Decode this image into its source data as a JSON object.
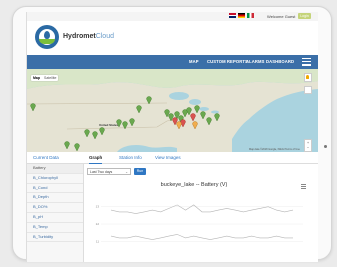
{
  "app": {
    "brand_bold": "Hydromet",
    "brand_light": "Cloud",
    "welcome": "Welcome Guest",
    "login": "Login"
  },
  "nav": {
    "map": "MAP",
    "custom_reports": "CUSTOM REPORTS",
    "alarms": "ALARMS",
    "dashboard": "DASHBOARD"
  },
  "map": {
    "toggle_map": "Map",
    "toggle_satellite": "Satellite",
    "label_united_states": "United States",
    "attribution": "Map data ©2018 Google, INEGI  Terms of Use"
  },
  "tabs": [
    "Current Data",
    "Graph",
    "Station Info",
    "View Images"
  ],
  "sidebar": [
    "Battery",
    "B_Chlorophyll",
    "B_Cond",
    "B_Depth",
    "B_DO%",
    "B_pH",
    "B_Temp",
    "B_Turbidity"
  ],
  "controls": {
    "range": "Last Two days",
    "run": "Run"
  },
  "chart_data": {
    "type": "line",
    "title": "buckeye_lake -- Battery (V)",
    "y_ticks": [
      "13",
      "12",
      "11"
    ],
    "series": [
      {
        "values": [
          12.8,
          12.7,
          12.7,
          12.6,
          12.7,
          12.8,
          12.7,
          12.9,
          13.1,
          12.8,
          13.1,
          12.7,
          12.7,
          12.8,
          12.9,
          12.8,
          12.7,
          12.8,
          12.9,
          13.0,
          12.8,
          12.7,
          12.8
        ]
      },
      {
        "values": [
          11.3,
          11.2,
          11.2,
          11.3,
          11.2,
          11.1,
          11.2,
          11.3,
          11.4,
          11.2,
          11.3,
          11.2,
          11.1,
          11.2,
          11.3,
          11.2,
          11.2,
          11.3,
          11.2,
          11.2,
          11.3,
          11.2,
          11.2
        ]
      }
    ]
  }
}
